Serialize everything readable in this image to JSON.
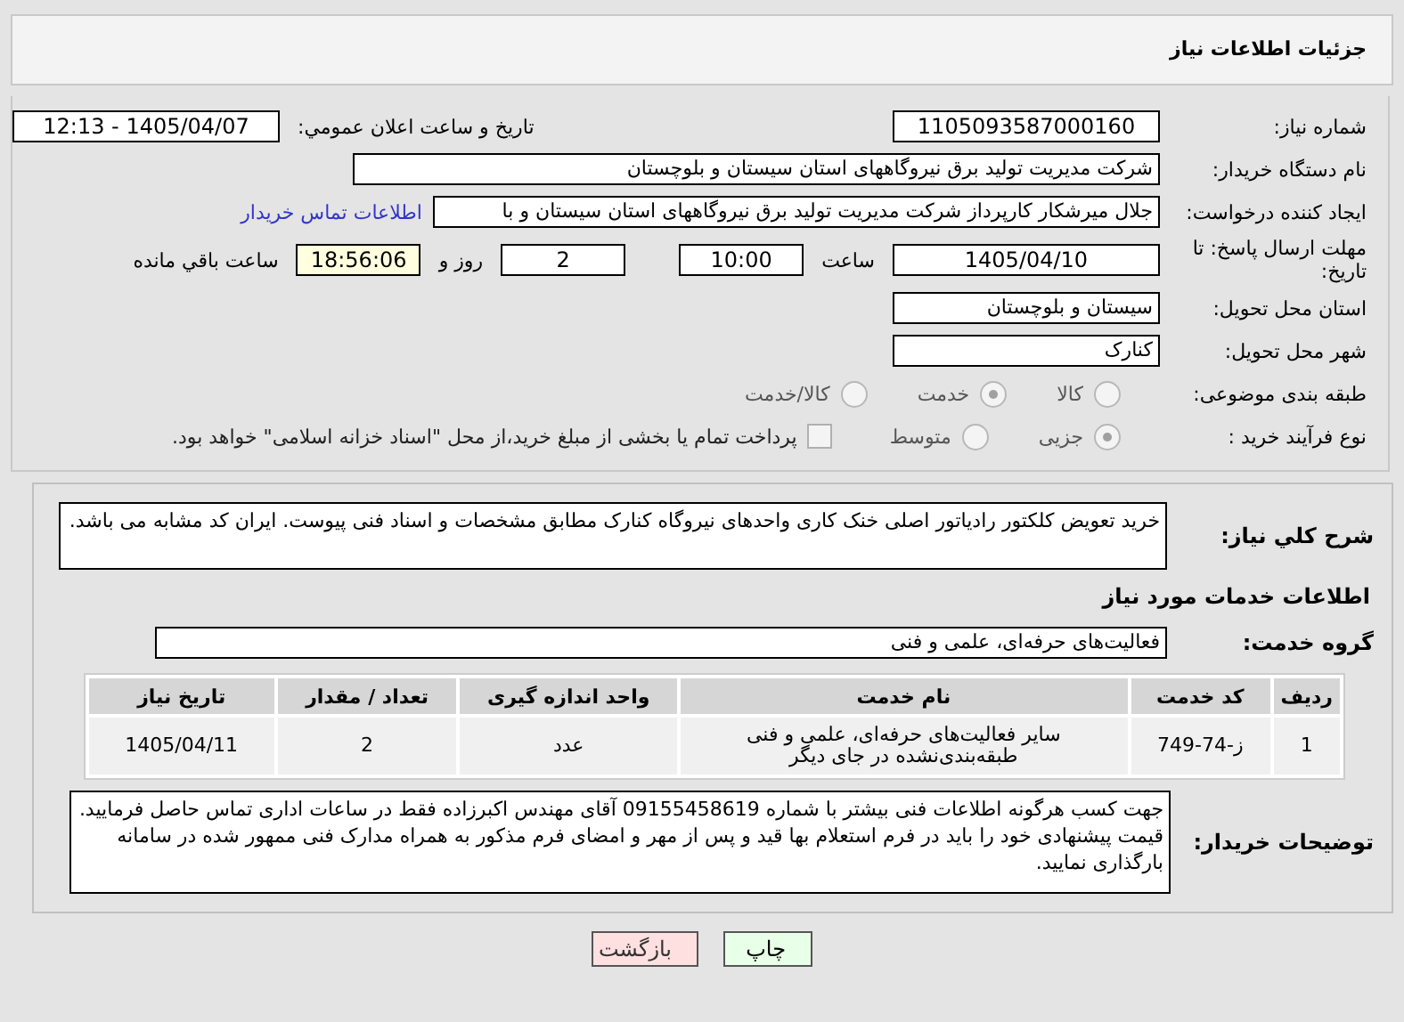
{
  "header": {
    "title": "جزئیات اطلاعات نیاز"
  },
  "need_number": {
    "label": "شماره نیاز:",
    "value": "1105093587000160"
  },
  "announce": {
    "label": "تاریخ و ساعت اعلان عمومي:",
    "value": "1405/04/07 - 12:13"
  },
  "buyer": {
    "label": "نام دستگاه خریدار:",
    "value": "شرکت مدیریت تولید برق نیروگاههای استان سیستان و بلوچستان"
  },
  "creator": {
    "label": "ایجاد کننده درخواست:",
    "value": "جلال میرشکار کارپرداز شرکت مدیریت تولید برق نیروگاههای استان سیستان و با",
    "link": "اطلاعات تماس خریدار"
  },
  "deadline": {
    "label": "مهلت ارسال پاسخ: تا تاریخ:",
    "date": "1405/04/10",
    "time_label": "ساعت",
    "time": "10:00",
    "days": "2",
    "days_label": "روز و",
    "remaining": "18:56:06",
    "remaining_label": "ساعت باقي مانده"
  },
  "province": {
    "label": "استان محل تحویل:",
    "value": "سیستان و بلوچستان"
  },
  "city": {
    "label": "شهر محل تحویل:",
    "value": "کنارک"
  },
  "category": {
    "label": "طبقه بندی موضوعی:",
    "options": [
      {
        "label": "کالا",
        "selected": false
      },
      {
        "label": "خدمت",
        "selected": true
      },
      {
        "label": "کالا/خدمت",
        "selected": false
      }
    ]
  },
  "process": {
    "label": "نوع فرآیند خرید :",
    "options": [
      {
        "label": "جزیی",
        "selected": true
      },
      {
        "label": "متوسط",
        "selected": false
      }
    ],
    "payment": {
      "checked": false,
      "text": "پرداخت تمام یا بخشی از مبلغ خرید،از محل \"اسناد خزانه اسلامی\" خواهد بود."
    }
  },
  "description": {
    "label": "شرح کلي نیاز:",
    "value": "خرید تعویض کلکتور رادیاتور اصلی خنک کاری واحدهای نیروگاه کنارک مطابق مشخصات و اسناد فنی پیوست. ایران کد مشابه می باشد."
  },
  "services_title": "اطلاعات خدمات مورد نیاز",
  "service_group": {
    "label": "گروه خدمت:",
    "value": "فعالیت‌های حرفه‌ای، علمی و فنی"
  },
  "table": {
    "columns": [
      "ردیف",
      "کد خدمت",
      "نام خدمت",
      "واحد اندازه گیری",
      "تعداد / مقدار",
      "تاریخ نیاز"
    ],
    "rows": [
      [
        "1",
        "ز-74-749",
        "سایر فعالیت‌های حرفه‌ای، علمی و فنی طبقه‌بندی‌نشده در جای دیگر",
        "عدد",
        "2",
        "1405/04/11"
      ]
    ]
  },
  "notes": {
    "label": "توضیحات خریدار:",
    "value": "جهت کسب هرگونه اطلاعات فنی بیشتر با شماره 09155458619 آقای مهندس اکبرزاده فقط در ساعات اداری تماس حاصل فرمایید. قیمت پیشنهادی خود را باید در فرم استعلام بها قید و پس از مهر و امضای فرم مذکور به همراه مدارک فنی ممهور شده در سامانه بارگذاری نمایید."
  },
  "buttons": [
    {
      "label": "چاپ",
      "kind": "print"
    },
    {
      "label": "بازگشت",
      "kind": "back"
    }
  ]
}
